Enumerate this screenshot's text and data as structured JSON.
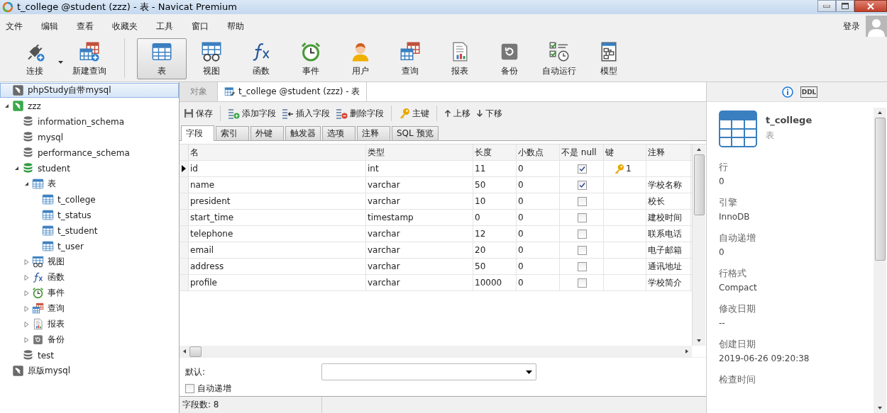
{
  "window": {
    "title": "t_college @student (zzz) - 表 - Navicat Premium"
  },
  "menu": [
    "文件",
    "编辑",
    "查看",
    "收藏夹",
    "工具",
    "窗口",
    "帮助"
  ],
  "account": {
    "label": "登录"
  },
  "toolbar": [
    {
      "kind": "connect",
      "label": "连接",
      "selected": false,
      "dropdown": true
    },
    {
      "kind": "newquery",
      "label": "新建查询",
      "selected": false,
      "dropdown": false
    },
    {
      "kind": "table",
      "label": "表",
      "selected": true,
      "dropdown": false
    },
    {
      "kind": "view",
      "label": "视图",
      "selected": false,
      "dropdown": false
    },
    {
      "kind": "function",
      "label": "函数",
      "selected": false,
      "dropdown": false
    },
    {
      "kind": "event",
      "label": "事件",
      "selected": false,
      "dropdown": false
    },
    {
      "kind": "user",
      "label": "用户",
      "selected": false,
      "dropdown": false
    },
    {
      "kind": "query",
      "label": "查询",
      "selected": false,
      "dropdown": false
    },
    {
      "kind": "report",
      "label": "报表",
      "selected": false,
      "dropdown": false
    },
    {
      "kind": "backup",
      "label": "备份",
      "selected": false,
      "dropdown": false
    },
    {
      "kind": "automation",
      "label": "自动运行",
      "selected": false,
      "dropdown": false
    },
    {
      "kind": "model",
      "label": "模型",
      "selected": false,
      "dropdown": false
    }
  ],
  "tree": [
    {
      "kind": "connection",
      "label": "phpStudy自带mysql",
      "open": false,
      "selected": true
    },
    {
      "kind": "connection",
      "label": "zzz",
      "open": true,
      "selected": false,
      "expanded": true,
      "children": [
        {
          "kind": "database",
          "label": "information_schema",
          "open": false,
          "selected": false
        },
        {
          "kind": "database",
          "label": "mysql",
          "open": false,
          "selected": false
        },
        {
          "kind": "database",
          "label": "performance_schema",
          "open": false,
          "selected": false
        },
        {
          "kind": "database",
          "label": "student",
          "open": true,
          "selected": false,
          "expanded": true,
          "children": [
            {
              "kind": "table",
              "label": "表",
              "selected": false,
              "expanded": true,
              "children": [
                {
                  "kind": "table",
                  "label": "t_college",
                  "selected": false
                },
                {
                  "kind": "table",
                  "label": "t_status",
                  "selected": false
                },
                {
                  "kind": "table",
                  "label": "t_student",
                  "selected": false
                },
                {
                  "kind": "table",
                  "label": "t_user",
                  "selected": false
                }
              ]
            },
            {
              "kind": "view",
              "label": "视图",
              "selected": false,
              "expanded": false
            },
            {
              "kind": "function",
              "label": "函数",
              "selected": false,
              "expanded": false
            },
            {
              "kind": "event",
              "label": "事件",
              "selected": false,
              "expanded": false
            },
            {
              "kind": "query",
              "label": "查询",
              "selected": false,
              "expanded": false
            },
            {
              "kind": "report",
              "label": "报表",
              "selected": false,
              "expanded": false
            },
            {
              "kind": "backup",
              "label": "备份",
              "selected": false,
              "expanded": false
            }
          ]
        },
        {
          "kind": "database",
          "label": "test",
          "open": false,
          "selected": false
        }
      ]
    },
    {
      "kind": "connection",
      "label": "原版mysql",
      "open": false,
      "selected": false
    }
  ],
  "doc_tabs": [
    {
      "label": "对象",
      "kind": "objects",
      "selected": false
    },
    {
      "label": "t_college @student (zzz) - 表",
      "kind": "table",
      "selected": true
    }
  ],
  "design_toolbar": [
    {
      "kind": "save",
      "label": "保存"
    },
    {
      "kind": "add",
      "label": "添加字段"
    },
    {
      "kind": "insert",
      "label": "插入字段"
    },
    {
      "kind": "delete",
      "label": "删除字段"
    },
    {
      "kind": "key",
      "label": "主键"
    },
    {
      "kind": "up",
      "label": "上移"
    },
    {
      "kind": "down",
      "label": "下移"
    }
  ],
  "sub_tabs": [
    {
      "label": "字段",
      "selected": true
    },
    {
      "label": "索引",
      "selected": false
    },
    {
      "label": "外键",
      "selected": false
    },
    {
      "label": "触发器",
      "selected": false
    },
    {
      "label": "选项",
      "selected": false
    },
    {
      "label": "注释",
      "selected": false
    },
    {
      "label": "SQL 预览",
      "selected": false
    }
  ],
  "table": {
    "columns": [
      "名",
      "类型",
      "长度",
      "小数点",
      "不是 null",
      "键",
      "注释"
    ],
    "rows": [
      {
        "name": "id",
        "type": "int",
        "length": "11",
        "decimals": "0",
        "not_null": true,
        "key": "1",
        "comment": "",
        "selected": true
      },
      {
        "name": "name",
        "type": "varchar",
        "length": "50",
        "decimals": "0",
        "not_null": true,
        "comment": "学校名称",
        "selected": false
      },
      {
        "name": "president",
        "type": "varchar",
        "length": "10",
        "decimals": "0",
        "not_null": false,
        "comment": "校长",
        "selected": false
      },
      {
        "name": "start_time",
        "type": "timestamp",
        "length": "0",
        "decimals": "0",
        "not_null": false,
        "comment": "建校时间",
        "selected": false
      },
      {
        "name": "telephone",
        "type": "varchar",
        "length": "12",
        "decimals": "0",
        "not_null": false,
        "comment": "联系电话",
        "selected": false
      },
      {
        "name": "email",
        "type": "varchar",
        "length": "20",
        "decimals": "0",
        "not_null": false,
        "comment": "电子邮箱",
        "selected": false
      },
      {
        "name": "address",
        "type": "varchar",
        "length": "50",
        "decimals": "0",
        "not_null": false,
        "comment": "通讯地址",
        "selected": false
      },
      {
        "name": "profile",
        "type": "varchar",
        "length": "10000",
        "decimals": "0",
        "not_null": false,
        "comment": "学校简介",
        "selected": false
      }
    ]
  },
  "field_props": {
    "default_label": "默认:",
    "auto_increment": {
      "label": "自动递增",
      "checked": false
    }
  },
  "status_bar": "字段数: 8",
  "info_panel": {
    "tabs": [
      {
        "kind": "info",
        "selected": true
      },
      {
        "kind": "ddl",
        "label": "DDL",
        "selected": false
      }
    ],
    "object_name": "t_college",
    "object_type": "表",
    "properties": [
      {
        "label": "行",
        "value": "0"
      },
      {
        "label": "引擎",
        "value": "InnoDB"
      },
      {
        "label": "自动递增",
        "value": "0"
      },
      {
        "label": "行格式",
        "value": "Compact"
      },
      {
        "label": "修改日期",
        "value": "--"
      },
      {
        "label": "创建日期",
        "value": "2019-06-26 09:20:38"
      },
      {
        "label": "检查时间"
      }
    ]
  }
}
